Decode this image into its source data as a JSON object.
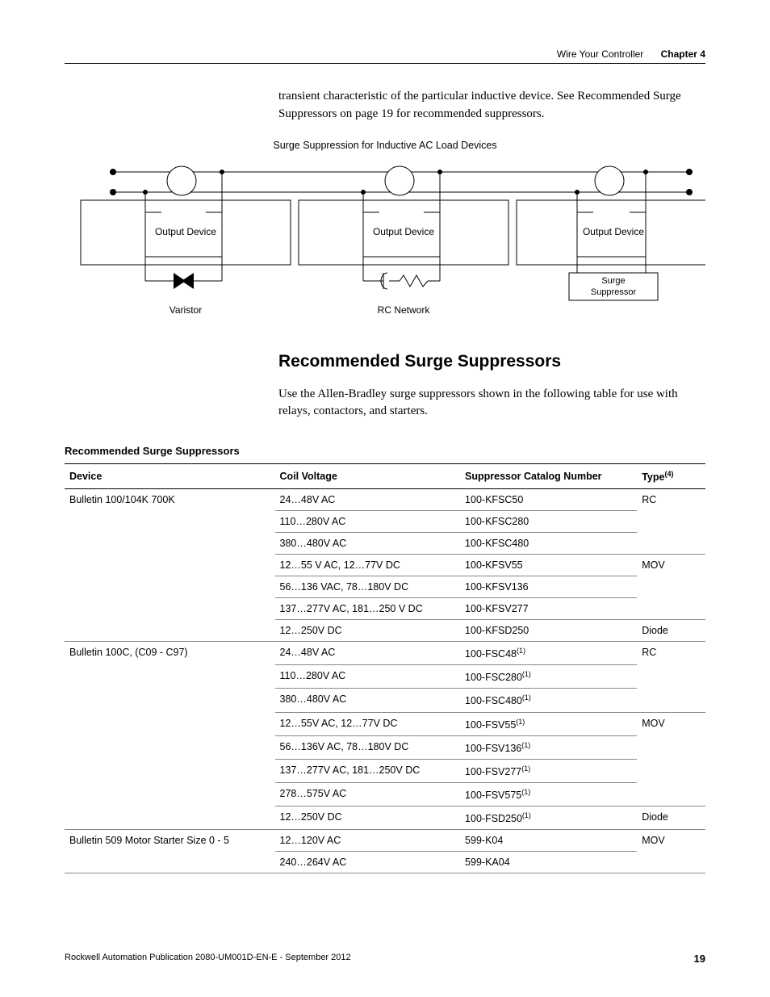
{
  "header": {
    "section": "Wire Your Controller",
    "chapter": "Chapter 4"
  },
  "intro": "transient characteristic of the particular inductive device. See Recommended Surge Suppressors on page 19 for recommended suppressors.",
  "diagram": {
    "title": "Surge Suppression for Inductive AC Load Devices",
    "labels": {
      "output_device": "Output Device",
      "varistor": "Varistor",
      "rc_network": "RC Network",
      "surge_suppressor_l1": "Surge",
      "surge_suppressor_l2": "Suppressor"
    }
  },
  "heading_recommended": "Recommended Surge Suppressors",
  "body_recommended": "Use the Allen-Bradley surge suppressors shown in the following table for use with relays, contactors, and starters.",
  "table": {
    "title": "Recommended Surge Suppressors",
    "headers": {
      "device": "Device",
      "coil": "Coil Voltage",
      "catalog": "Suppressor Catalog Number",
      "type": "Type",
      "type_sup": "(4)"
    },
    "rows": [
      {
        "device": "Bulletin 100/104K 700K",
        "coil": "24…48V AC",
        "catalog": "100-KFSC50",
        "catalog_sup": "",
        "type": "RC",
        "show_device": true,
        "show_type": true,
        "device_rows": 7,
        "type_rows": 3
      },
      {
        "device": "",
        "coil": "110…280V AC",
        "catalog": "100-KFSC280",
        "catalog_sup": "",
        "type": "",
        "show_device": false,
        "show_type": false
      },
      {
        "device": "",
        "coil": "380…480V AC",
        "catalog": "100-KFSC480",
        "catalog_sup": "",
        "type": "",
        "show_device": false,
        "show_type": false
      },
      {
        "device": "",
        "coil": "12…55 V AC, 12…77V DC",
        "catalog": "100-KFSV55",
        "catalog_sup": "",
        "type": "MOV",
        "show_device": false,
        "show_type": true,
        "type_rows": 3
      },
      {
        "device": "",
        "coil": "56…136 VAC, 78…180V DC",
        "catalog": "100-KFSV136",
        "catalog_sup": "",
        "type": "",
        "show_device": false,
        "show_type": false
      },
      {
        "device": "",
        "coil": "137…277V AC, 181…250 V DC",
        "catalog": "100-KFSV277",
        "catalog_sup": "",
        "type": "",
        "show_device": false,
        "show_type": false
      },
      {
        "device": "",
        "coil": "12…250V DC",
        "catalog": "100-KFSD250",
        "catalog_sup": "",
        "type": "Diode",
        "show_device": false,
        "show_type": true,
        "type_rows": 1
      },
      {
        "device": "Bulletin 100C, (C09 - C97)",
        "coil": "24…48V AC",
        "catalog": "100-FSC48",
        "catalog_sup": "(1)",
        "type": "RC",
        "show_device": true,
        "show_type": true,
        "device_rows": 8,
        "type_rows": 3
      },
      {
        "device": "",
        "coil": "110…280V AC",
        "catalog": "100-FSC280",
        "catalog_sup": "(1)",
        "type": "",
        "show_device": false,
        "show_type": false
      },
      {
        "device": "",
        "coil": "380…480V AC",
        "catalog": "100-FSC480",
        "catalog_sup": "(1)",
        "type": "",
        "show_device": false,
        "show_type": false
      },
      {
        "device": "",
        "coil": "12…55V AC, 12…77V DC",
        "catalog": "100-FSV55",
        "catalog_sup": "(1)",
        "type": "MOV",
        "show_device": false,
        "show_type": true,
        "type_rows": 4
      },
      {
        "device": "",
        "coil": "56…136V AC, 78…180V DC",
        "catalog": "100-FSV136",
        "catalog_sup": "(1)",
        "type": "",
        "show_device": false,
        "show_type": false
      },
      {
        "device": "",
        "coil": "137…277V AC, 181…250V DC",
        "catalog": "100-FSV277",
        "catalog_sup": "(1)",
        "type": "",
        "show_device": false,
        "show_type": false
      },
      {
        "device": "",
        "coil": "278…575V AC",
        "catalog": "100-FSV575",
        "catalog_sup": "(1)",
        "type": "",
        "show_device": false,
        "show_type": false
      },
      {
        "device": "",
        "coil": "12…250V DC",
        "catalog": "100-FSD250",
        "catalog_sup": "(1)",
        "type": "Diode",
        "show_device": false,
        "show_type": true,
        "type_rows": 1
      },
      {
        "device": "Bulletin 509 Motor Starter Size 0 - 5",
        "coil": "12…120V AC",
        "catalog": "599-K04",
        "catalog_sup": "",
        "type": "MOV",
        "show_device": true,
        "show_type": true,
        "device_rows": 2,
        "type_rows": 2
      },
      {
        "device": "",
        "coil": "240…264V AC",
        "catalog": "599-KA04",
        "catalog_sup": "",
        "type": "",
        "show_device": false,
        "show_type": false
      }
    ]
  },
  "footer": {
    "pub": "Rockwell Automation Publication 2080-UM001D-EN-E - September 2012",
    "page": "19"
  }
}
